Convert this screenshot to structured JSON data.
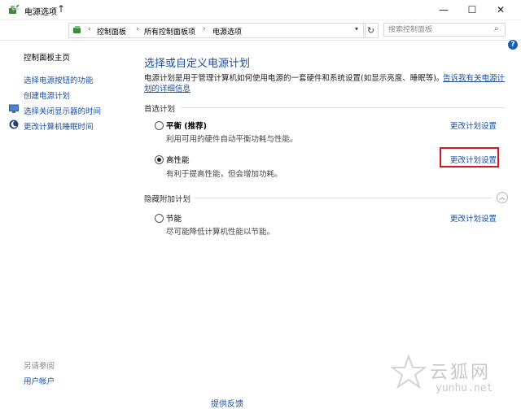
{
  "window": {
    "title": "电源选项",
    "controls": {
      "minimize": "—",
      "maximize": "☐",
      "close": "✕"
    }
  },
  "nav": {
    "back": "←",
    "forward": "→",
    "recent": "⌄",
    "up": "↑",
    "breadcrumbs": [
      "控制面板",
      "所有控制面板项",
      "电源选项"
    ],
    "search_placeholder": "搜索控制面板",
    "help": "?"
  },
  "sidebar": {
    "home": "控制面板主页",
    "items": [
      {
        "label": "选择电源按钮的功能",
        "icon": ""
      },
      {
        "label": "创建电源计划",
        "icon": ""
      },
      {
        "label": "选择关闭显示器的时间",
        "icon": "monitor-icon"
      },
      {
        "label": "更改计算机睡眠时间",
        "icon": "moon-icon"
      }
    ],
    "see_also": "另请参阅",
    "user_accounts": "用户帐户"
  },
  "main": {
    "title": "选择或自定义电源计划",
    "description_text": "电源计划是用于管理计算机如何使用电源的一套硬件和系统设置(如显示亮度、睡眠等)。",
    "description_link_part1": "告诉我有关电源计",
    "description_link_part2": "划的详细信息",
    "preferred_section": "首选计划",
    "hidden_section": "隐藏附加计划",
    "plans": [
      {
        "name": "平衡 (推荐)",
        "desc": "利用可用的硬件自动平衡功耗与性能。",
        "link": "更改计划设置",
        "selected": false
      },
      {
        "name": "高性能",
        "desc": "有利于提高性能，但会增加功耗。",
        "link": "更改计划设置",
        "selected": true
      },
      {
        "name": "节能",
        "desc": "尽可能降低计算机性能以节能。",
        "link": "更改计划设置",
        "selected": false
      }
    ],
    "bottom_cut_text": "提供反馈"
  },
  "watermark": {
    "text": "云狐网",
    "url": "yunhu.net"
  },
  "colors": {
    "link": "#1a4fa3",
    "title": "#1e4d9a",
    "highlight": "#d6161c"
  }
}
